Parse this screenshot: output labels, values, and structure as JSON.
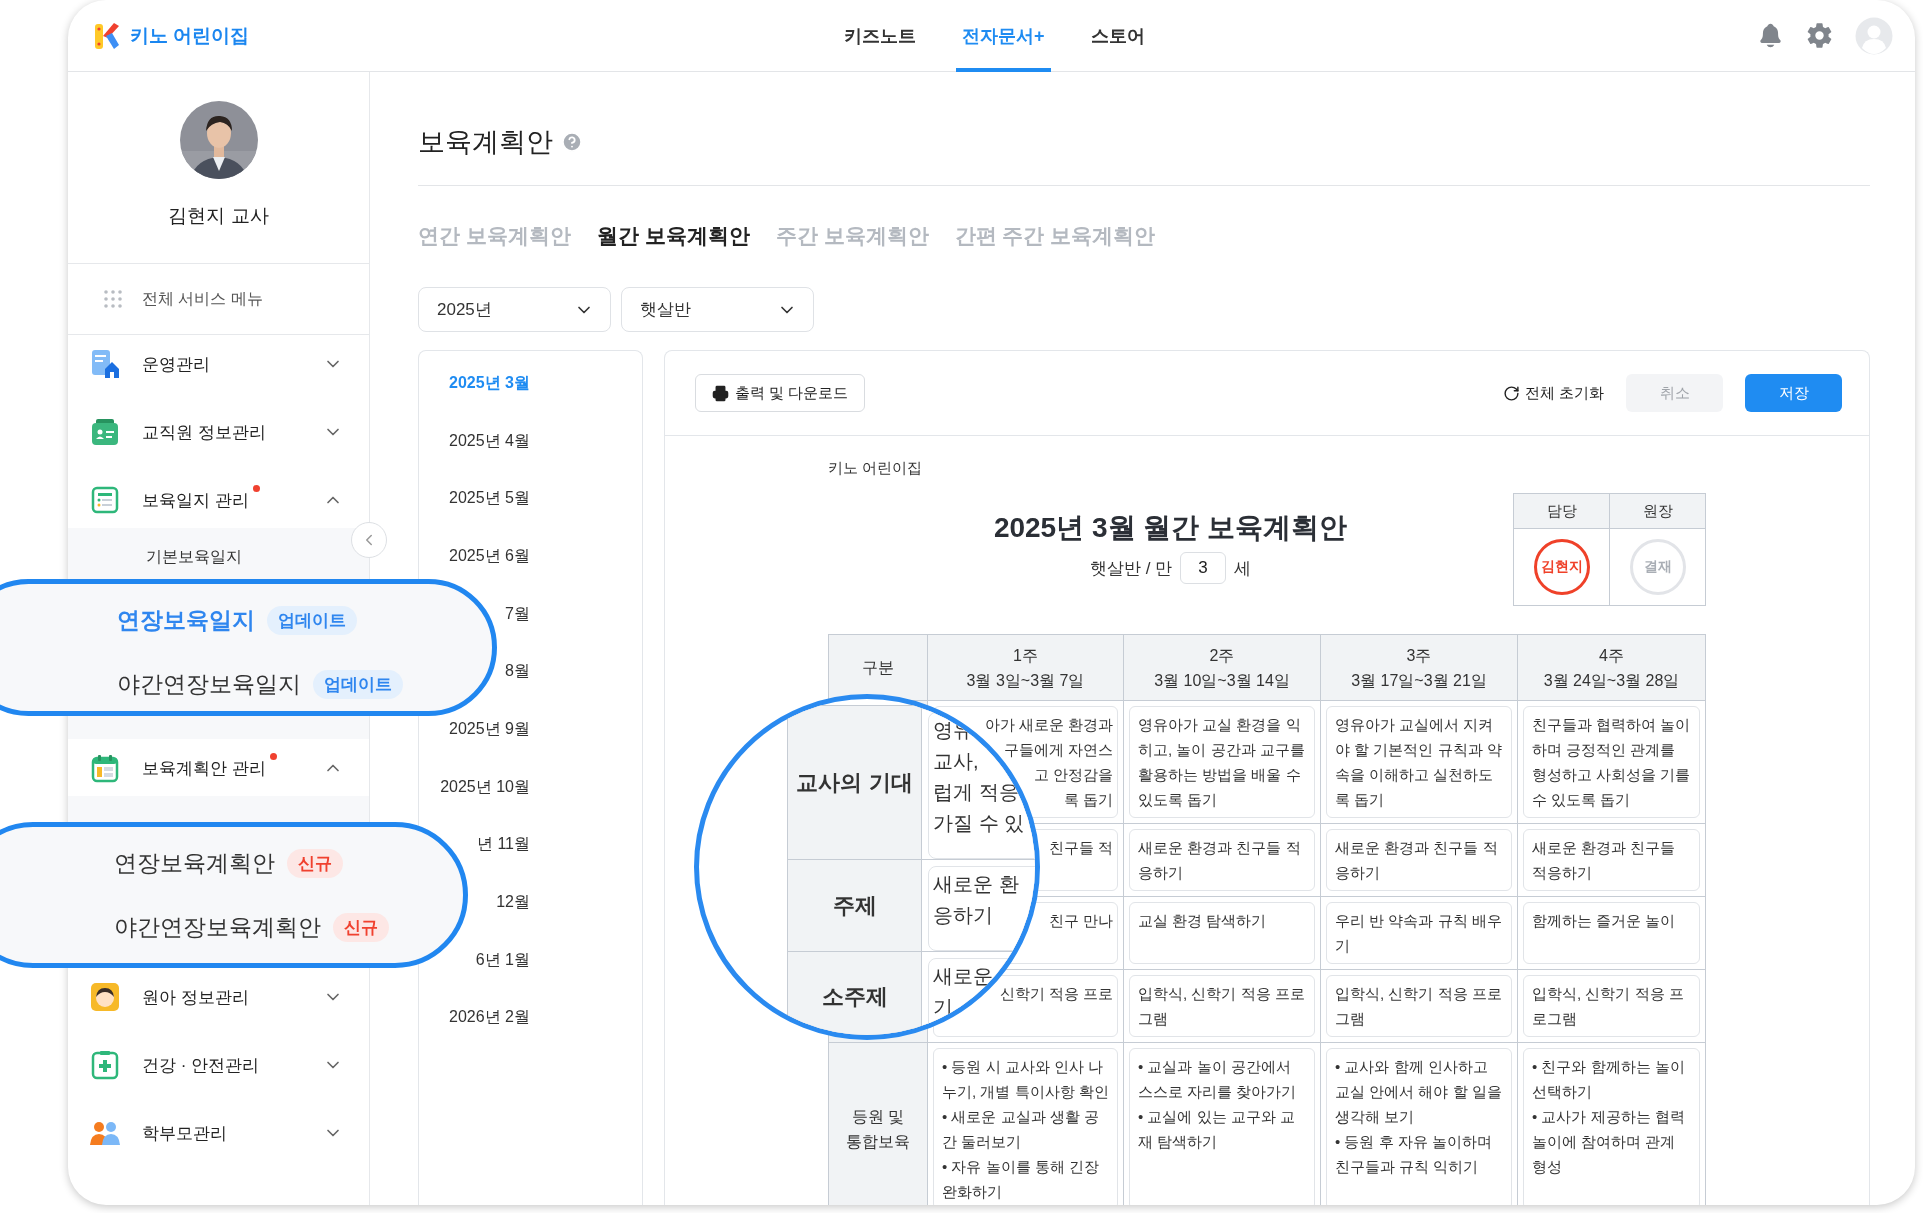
{
  "header": {
    "brand": "키노 어린이집",
    "nav": [
      {
        "label": "키즈노트",
        "selected": false
      },
      {
        "label": "전자문서+",
        "selected": true
      },
      {
        "label": "스토어",
        "selected": false
      }
    ]
  },
  "sidebar": {
    "profile_name": "김현지 교사",
    "all_menu": "전체 서비스 메뉴",
    "items": [
      {
        "kind": "ops",
        "label": "운영관리",
        "expanded": false,
        "dot": false
      },
      {
        "kind": "staff",
        "label": "교직원 정보관리",
        "expanded": false,
        "dot": false
      },
      {
        "kind": "journal",
        "label": "보육일지 관리",
        "expanded": true,
        "dot": true,
        "children": [
          {
            "label": "기본보육일지"
          }
        ]
      },
      {
        "kind": "plan",
        "label": "보육계획안 관리",
        "expanded": true,
        "dot": true
      },
      {
        "kind": "child",
        "label": "원아 정보관리",
        "expanded": false,
        "dot": false
      },
      {
        "kind": "health",
        "label": "건강 · 안전관리",
        "expanded": false,
        "dot": false
      },
      {
        "kind": "parents",
        "label": "학부모관리",
        "expanded": false,
        "dot": false
      }
    ]
  },
  "callouts": [
    {
      "items": [
        {
          "label": "연장보육일지",
          "badge": "업데이트",
          "kind": "update",
          "selected": true
        },
        {
          "label": "야간연장보육일지",
          "badge": "업데이트",
          "kind": "update",
          "selected": false
        }
      ]
    },
    {
      "items": [
        {
          "label": "연장보육계획안",
          "badge": "신규",
          "kind": "new",
          "selected": false
        },
        {
          "label": "야간연장보육계획안",
          "badge": "신규",
          "kind": "new",
          "selected": false
        }
      ]
    }
  ],
  "page": {
    "title": "보육계획안",
    "tabs": [
      {
        "label": "연간 보육계획안",
        "selected": false
      },
      {
        "label": "월간 보육계획안",
        "selected": true
      },
      {
        "label": "주간 보육계획안",
        "selected": false
      },
      {
        "label": "간편 주간 보육계획안",
        "selected": false
      }
    ],
    "filters": [
      "2025년",
      "햇살반"
    ],
    "months": [
      {
        "label": "2025년 3월",
        "selected": true
      },
      {
        "label": "2025년 4월",
        "selected": false
      },
      {
        "label": "2025년 5월",
        "selected": false
      },
      {
        "label": "2025년 6월",
        "selected": false
      },
      {
        "label": "7월",
        "selected": false
      },
      {
        "label": "8월",
        "selected": false
      },
      {
        "label": "2025년 9월",
        "selected": false
      },
      {
        "label": "2025년 10월",
        "selected": false
      },
      {
        "label": "년 11월",
        "selected": false
      },
      {
        "label": "12월",
        "selected": false
      },
      {
        "label": "6년 1월",
        "selected": false
      },
      {
        "label": "2026년 2월",
        "selected": false
      }
    ]
  },
  "toolbar": {
    "print": "출력 및 다운로드",
    "reset": "전체 초기화",
    "cancel": "취소",
    "save": "저장"
  },
  "document": {
    "org": "키노 어린이집",
    "title": "2025년 3월 월간 보육계획안",
    "class_label": "햇살반 / 만",
    "age": "3",
    "age_unit": "세",
    "approval": [
      {
        "role": "담당",
        "stamp": "김현지",
        "signed": true
      },
      {
        "role": "원장",
        "stamp": "결재",
        "signed": false
      }
    ],
    "table": {
      "corner": "구분",
      "columns": [
        {
          "week": "1주",
          "range": "3월 3일~3월 7일"
        },
        {
          "week": "2주",
          "range": "3월 10일~3월 14일"
        },
        {
          "week": "3주",
          "range": "3월 17일~3월 21일"
        },
        {
          "week": "4주",
          "range": "3월 24일~3월 28일"
        }
      ],
      "rows": [
        {
          "cells": [
            {
              "kind": "fragment",
              "lines": [
                "아가 새로운 환경과",
                "구들에게 자연스",
                "고 안정감을",
                "록 돕기"
              ]
            },
            {
              "kind": "text",
              "text": "영유아가 교실 환경을 익히고, 놀이 공간과 교구를 활용하는 방법을 배울 수 있도록 돕기"
            },
            {
              "kind": "text",
              "text": "영유아가 교실에서 지켜야 할 기본적인 규칙과 약속을 이해하고 실천하도록 돕기"
            },
            {
              "kind": "text",
              "text": "친구들과 협력하여 놀이하며 긍정적인 관계를 형성하고 사회성을 기를 수 있도록 돕기"
            }
          ]
        },
        {
          "cells": [
            {
              "kind": "fragment",
              "lines": [
                "친구들 적"
              ]
            },
            {
              "kind": "text",
              "text": "새로운 환경과 친구들 적응하기"
            },
            {
              "kind": "text",
              "text": "새로운 환경과 친구들 적응하기"
            },
            {
              "kind": "text",
              "text": "새로운 환경과 친구들 적응하기"
            }
          ]
        },
        {
          "cells": [
            {
              "kind": "fragment",
              "lines": [
                "친구 만나"
              ]
            },
            {
              "kind": "text",
              "text": "교실 환경 탐색하기"
            },
            {
              "kind": "text",
              "text": "우리 반 약속과 규칙 배우기"
            },
            {
              "kind": "text",
              "text": "함께하는 즐거운 놀이"
            }
          ]
        },
        {
          "cells": [
            {
              "kind": "fragment",
              "lines": [
                "신학기 적응 프로"
              ]
            },
            {
              "kind": "text",
              "text": "입학식, 신학기 적응 프로그램"
            },
            {
              "kind": "text",
              "text": "입학식, 신학기 적응 프로그램"
            },
            {
              "kind": "text",
              "text": "입학식, 신학기 적응 프로그램"
            }
          ]
        },
        {
          "header": "등원 및\n통합보육",
          "cells": [
            {
              "kind": "bullets",
              "items": [
                "• 등원 시 교사와 인사 나누기, 개별 특이사항 확인",
                "• 새로운 교실과 생활 공간 둘러보기",
                "• 자유 놀이를 통해 긴장 완화하기"
              ]
            },
            {
              "kind": "bullets",
              "items": [
                "• 교실과 놀이 공간에서 스스로 자리를 찾아가기",
                "• 교실에 있는 교구와 교재 탐색하기"
              ]
            },
            {
              "kind": "bullets",
              "items": [
                "• 교사와 함께 인사하고 교실 안에서 해야 할 일을 생각해 보기",
                "• 등원 후 자유 놀이하며 친구들과 규칙 익히기"
              ]
            },
            {
              "kind": "bullets",
              "items": [
                "• 친구와 함께하는 놀이 선택하기",
                "• 교사가 제공하는 협력 놀이에 참여하며 관계 형성"
              ]
            }
          ]
        }
      ]
    }
  },
  "magnifier": {
    "rows": [
      {
        "header": "교사의 기대",
        "lines": [
          "영유",
          "교사,",
          "럽게 적응",
          "가질 수 있"
        ]
      },
      {
        "header": "주제",
        "lines": [
          "새로운 환",
          "응하기"
        ]
      },
      {
        "header": "소주제",
        "lines": [
          "새로운",
          "기"
        ]
      }
    ]
  }
}
